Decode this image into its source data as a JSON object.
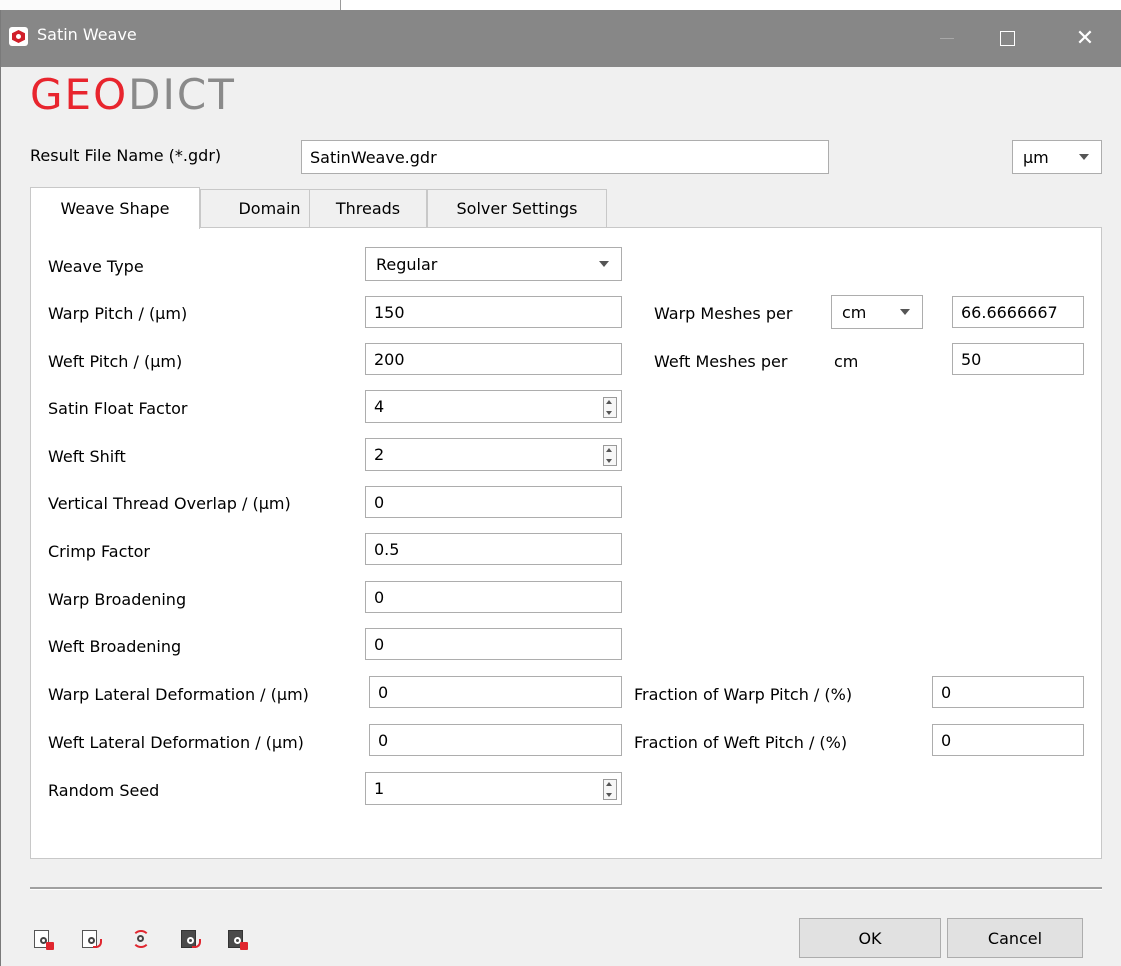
{
  "window": {
    "title": "Satin Weave"
  },
  "logo": {
    "part1": "GEO",
    "part2": "DICT"
  },
  "result": {
    "label": "Result File Name (*.gdr)",
    "value": "SatinWeave.gdr"
  },
  "unit_select": {
    "value": "µm"
  },
  "tabs": [
    {
      "label": "Weave Shape",
      "active": true
    },
    {
      "label": "Domain"
    },
    {
      "label": "Threads"
    },
    {
      "label": "Solver Settings"
    }
  ],
  "weave_shape": {
    "weave_type": {
      "label": "Weave Type",
      "value": "Regular"
    },
    "warp_pitch": {
      "label": "Warp Pitch / (µm)",
      "value": "150"
    },
    "weft_pitch": {
      "label": "Weft Pitch / (µm)",
      "value": "200"
    },
    "warp_meshes": {
      "label": "Warp Meshes per",
      "unit": "cm",
      "value": "66.6666667"
    },
    "weft_meshes": {
      "label": "Weft Meshes per",
      "unit": "cm",
      "value": "50"
    },
    "satin_float_factor": {
      "label": "Satin Float Factor",
      "value": "4"
    },
    "weft_shift": {
      "label": "Weft Shift",
      "value": "2"
    },
    "vertical_overlap": {
      "label": "Vertical Thread Overlap / (µm)",
      "value": "0"
    },
    "crimp_factor": {
      "label": "Crimp Factor",
      "value": "0.5"
    },
    "warp_broadening": {
      "label": "Warp Broadening",
      "value": "0"
    },
    "weft_broadening": {
      "label": "Weft Broadening",
      "value": "0"
    },
    "warp_lateral": {
      "label": "Warp Lateral Deformation / (µm)",
      "value": "0"
    },
    "warp_fraction": {
      "label": "Fraction of Warp Pitch / (%)",
      "value": "0"
    },
    "weft_lateral": {
      "label": "Weft Lateral Deformation / (µm)",
      "value": "0"
    },
    "weft_fraction": {
      "label": "Fraction of Weft Pitch / (%)",
      "value": "0"
    },
    "random_seed": {
      "label": "Random Seed",
      "value": "1"
    }
  },
  "buttons": {
    "ok": "OK",
    "cancel": "Cancel"
  },
  "colors": {
    "titlebar": "#878787",
    "logo_red": "#e8252e",
    "logo_gray": "#8a8a8a",
    "accent_red": "#e0262f"
  }
}
